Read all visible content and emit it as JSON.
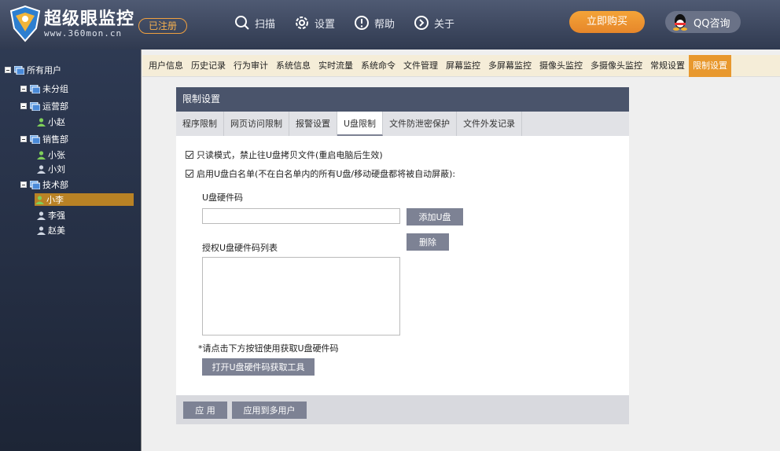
{
  "header": {
    "brand_name": "超级眼监控",
    "brand_url": "www.360mon.cn",
    "registered_badge": "已注册",
    "nav": [
      {
        "label": "扫描",
        "icon": "search-icon"
      },
      {
        "label": "设置",
        "icon": "gear-icon"
      },
      {
        "label": "帮助",
        "icon": "help-icon"
      },
      {
        "label": "关于",
        "icon": "about-icon"
      }
    ],
    "buy_label": "立即购买",
    "qq_label": "QQ咨询"
  },
  "sidebar": {
    "tree": [
      {
        "label": "所有用户",
        "type": "group"
      },
      {
        "label": "未分组",
        "type": "group"
      },
      {
        "label": "运营部",
        "type": "group"
      },
      {
        "label": "小赵",
        "type": "user"
      },
      {
        "label": "销售部",
        "type": "group"
      },
      {
        "label": "小张",
        "type": "user"
      },
      {
        "label": "小刘",
        "type": "user"
      },
      {
        "label": "技术部",
        "type": "group"
      },
      {
        "label": "小李",
        "type": "user",
        "selected": true
      },
      {
        "label": "李强",
        "type": "user"
      },
      {
        "label": "赵美",
        "type": "user"
      }
    ]
  },
  "menu": [
    "用户信息",
    "历史记录",
    "行为审计",
    "系统信息",
    "实时流量",
    "系统命令",
    "文件管理",
    "屏幕监控",
    "多屏幕监控",
    "摄像头监控",
    "多摄像头监控",
    "常规设置",
    "限制设置"
  ],
  "menu_active": "限制设置",
  "panel": {
    "title": "限制设置",
    "tabs": [
      "程序限制",
      "网页访问限制",
      "报警设置",
      "U盘限制",
      "文件防泄密保护",
      "文件外发记录"
    ],
    "active_tab": "U盘限制",
    "readonly_label": "只读模式，禁止往U盘拷贝文件(重启电脑后生效)",
    "whitelist_label": "启用U盘白名单(不在白名单内的所有U盘/移动硬盘都将被自动屏蔽):",
    "hardware_code_label": "U盘硬件码",
    "hardware_code_value": "",
    "add_button": "添加U盘",
    "delete_button": "删除",
    "list_label": "授权U盘硬件码列表",
    "hint": "*请点击下方按钮使用获取U盘硬件码",
    "tool_button": "打开U盘硬件码获取工具",
    "apply_button": "应 用",
    "apply_all_button": "应用到多用户"
  },
  "colors": {
    "header_bg": "#3d475d",
    "accent_orange": "#e8982e",
    "sidebar_selected": "#b98225",
    "panel_title_bg": "#4a546b",
    "button_gray": "#7d8294"
  }
}
